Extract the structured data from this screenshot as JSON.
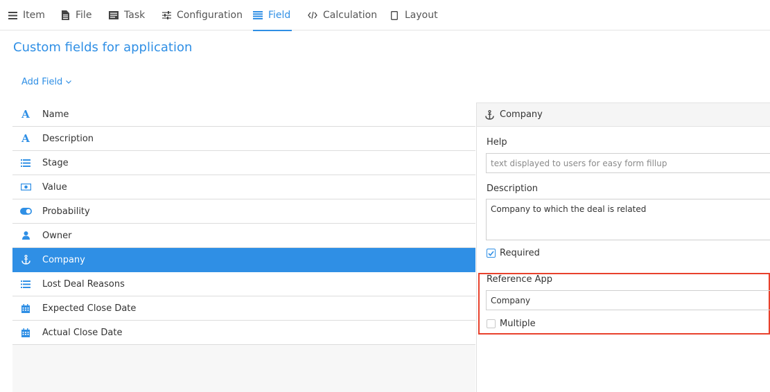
{
  "tabs": [
    {
      "label": "Item",
      "icon": "menu-icon"
    },
    {
      "label": "File",
      "icon": "file-icon"
    },
    {
      "label": "Task",
      "icon": "task-list-icon"
    },
    {
      "label": "Configuration",
      "icon": "sliders-icon"
    },
    {
      "label": "Field",
      "icon": "list-icon",
      "active": true
    },
    {
      "label": "Calculation",
      "icon": "code-icon"
    },
    {
      "label": "Layout",
      "icon": "tablet-icon"
    }
  ],
  "page_title": "Custom fields for application",
  "add_field_label": "Add Field",
  "fields": [
    {
      "label": "Name",
      "icon": "text-icon"
    },
    {
      "label": "Description",
      "icon": "text-icon"
    },
    {
      "label": "Stage",
      "icon": "list-icon"
    },
    {
      "label": "Value",
      "icon": "money-icon"
    },
    {
      "label": "Probability",
      "icon": "toggle-icon"
    },
    {
      "label": "Owner",
      "icon": "user-icon"
    },
    {
      "label": "Company",
      "icon": "anchor-icon",
      "selected": true
    },
    {
      "label": "Lost Deal Reasons",
      "icon": "list-icon"
    },
    {
      "label": "Expected Close Date",
      "icon": "calendar-icon"
    },
    {
      "label": "Actual Close Date",
      "icon": "calendar-icon"
    }
  ],
  "detail": {
    "title": "Company",
    "help_label": "Help",
    "help_placeholder": "text displayed to users for easy form fillup",
    "description_label": "Description",
    "description_value": "Company to which the deal is related",
    "required_label": "Required",
    "required_checked": true,
    "reference_app_label": "Reference App",
    "reference_app_value": "Company",
    "multiple_label": "Multiple",
    "multiple_checked": false
  },
  "colors": {
    "accent": "#2f8fe5",
    "highlight": "#e8412c"
  }
}
